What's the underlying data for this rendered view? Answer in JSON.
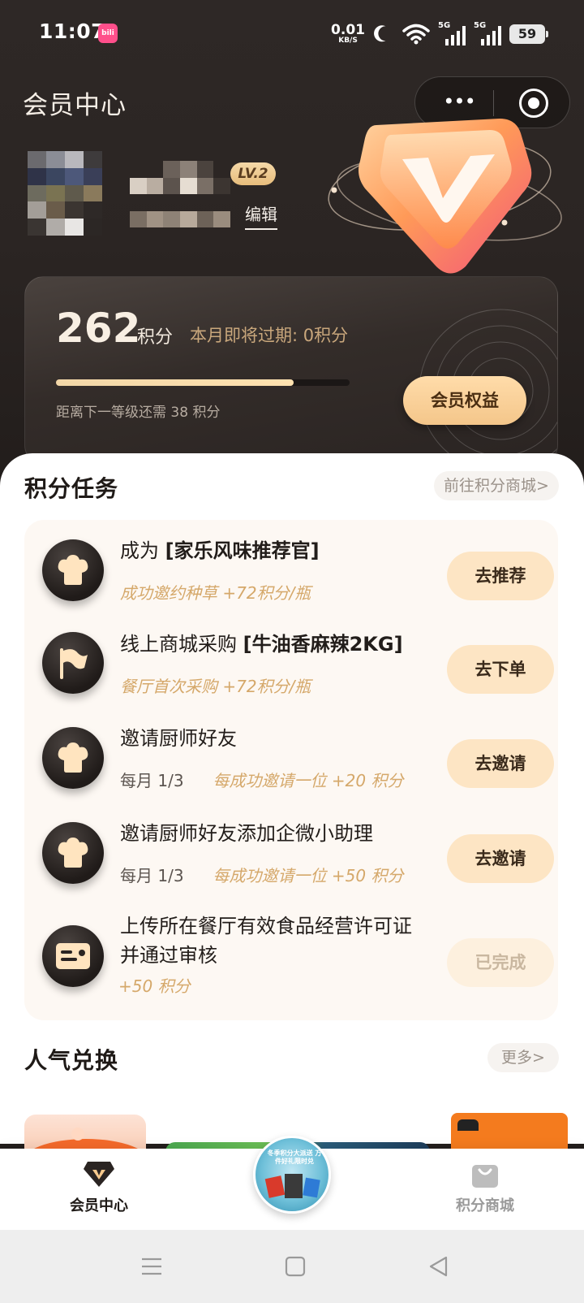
{
  "status_bar": {
    "time": "11:07",
    "app_icon_text": "bili",
    "net_speed_value": "0.01",
    "net_speed_unit": "KB/S",
    "signal_1": "5G",
    "signal_2": "5G",
    "battery": "59"
  },
  "header": {
    "title": "会员中心",
    "more_label": "•••"
  },
  "profile": {
    "level": "LV.2",
    "edit_label": "编辑"
  },
  "points_card": {
    "points": "262",
    "points_unit": "积分",
    "expire_text": "本月即将过期: 0积分",
    "progress_fraction": 0.81,
    "next_level_text": "距离下一等级还需 38 积分",
    "benefits_button": "会员权益"
  },
  "tasks_section": {
    "title": "积分任务",
    "mall_link": "前往积分商城>",
    "tasks": [
      {
        "title_prefix": "成为 ",
        "title_bold": "[家乐风味推荐官]",
        "meta": "",
        "reward": "成功邀约种草 +72积分/瓶",
        "button": "去推荐",
        "icon": "chef-hat-icon"
      },
      {
        "title_prefix": "线上商城采购 ",
        "title_bold": "[牛油香麻辣2KG]",
        "meta": "",
        "reward": "餐厅首次采购 +72积分/瓶",
        "button": "去下单",
        "icon": "flag-icon"
      },
      {
        "title_prefix": "邀请厨师好友",
        "title_bold": "",
        "meta": "每月 1/3",
        "reward": "每成功邀请一位 +20 积分",
        "button": "去邀请",
        "icon": "chef-hat-icon"
      },
      {
        "title_prefix": "邀请厨师好友添加企微小助理",
        "title_bold": "",
        "meta": "每月 1/3",
        "reward": "每成功邀请一位 +50 积分",
        "button": "去邀请",
        "icon": "chef-hat-icon"
      },
      {
        "title_line1": "上传所在餐厅有效食品经营许可证",
        "title_line2": "并通过审核",
        "reward": "+50 积分",
        "button": "已完成",
        "icon": "license-card-icon"
      }
    ]
  },
  "redeem_section": {
    "title": "人气兑换",
    "more_link": "更多>"
  },
  "tab_bar": {
    "tab_member": "会员中心",
    "tab_mall": "积分商城",
    "center_badge_text": "冬季积分大派送 万件好礼限时兑"
  },
  "colors": {
    "accent_gold": "#f4c68a",
    "reward_text": "#d5a86a",
    "hero_bg": "#2b2523"
  }
}
